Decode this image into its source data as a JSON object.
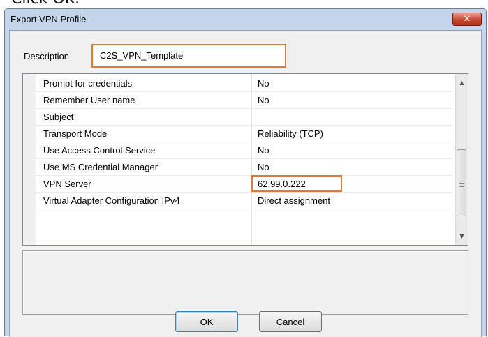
{
  "caption": "Click OK.",
  "dialog": {
    "title": "Export VPN Profile",
    "close_glyph": "✕",
    "description_label": "Description",
    "description_value": "C2S_VPN_Template",
    "properties": [
      {
        "name": "Prompt for credentials",
        "value": "No"
      },
      {
        "name": "Remember User name",
        "value": "No"
      },
      {
        "name": "Subject",
        "value": ""
      },
      {
        "name": "Transport Mode",
        "value": "Reliability (TCP)"
      },
      {
        "name": "Use Access Control Service",
        "value": "No"
      },
      {
        "name": "Use MS Credential Manager",
        "value": "No"
      },
      {
        "name": "VPN Server",
        "value": "62.99.0.222"
      },
      {
        "name": "Virtual Adapter Configuration IPv4",
        "value": "Direct assignment"
      }
    ],
    "ok_label": "OK",
    "cancel_label": "Cancel"
  },
  "colors": {
    "highlight": "#e8782e",
    "dialog_frame": "#c4d5ea",
    "close_button": "#c7462f"
  }
}
